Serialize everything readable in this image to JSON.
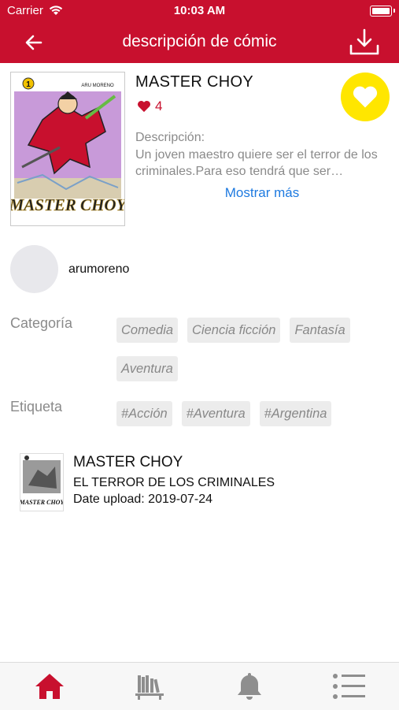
{
  "status_bar": {
    "carrier": "Carrier",
    "time": "10:03 AM"
  },
  "nav": {
    "title": "descripción de cómic",
    "back_icon": "arrow-left-icon",
    "download_icon": "download-icon"
  },
  "comic": {
    "title": "MASTER CHOY",
    "likes": "4",
    "description_label": "Descripción:",
    "description": "Un joven maestro quiere ser el terror de los criminales.Para eso tendrá que ser…",
    "show_more": "Mostrar más",
    "cover_logo": "MASTER CHOY",
    "cover_author": "ARU MORENO",
    "cover_volume": "1"
  },
  "author": {
    "username": "arumoreno"
  },
  "category": {
    "label": "Categoría",
    "items": [
      "Comedia",
      "Ciencia ficción",
      "Fantasía",
      "Aventura"
    ]
  },
  "tags": {
    "label": "Etiqueta",
    "items": [
      "#Acción",
      "#Aventura",
      "#Argentina"
    ]
  },
  "chapter": {
    "title": "MASTER CHOY",
    "subtitle": "EL TERROR DE LOS CRIMINALES",
    "date": "Date upload: 2019-07-24",
    "thumb_logo": "MASTER CHOY"
  },
  "tabbar": {
    "items": [
      {
        "icon": "home-icon",
        "active": true
      },
      {
        "icon": "library-icon",
        "active": false
      },
      {
        "icon": "bell-icon",
        "active": false
      },
      {
        "icon": "menu-list-icon",
        "active": false
      }
    ]
  },
  "colors": {
    "accent": "#c8102e",
    "favorite": "#ffe600",
    "link": "#1e7ae0",
    "muted": "#8a8a8a"
  }
}
